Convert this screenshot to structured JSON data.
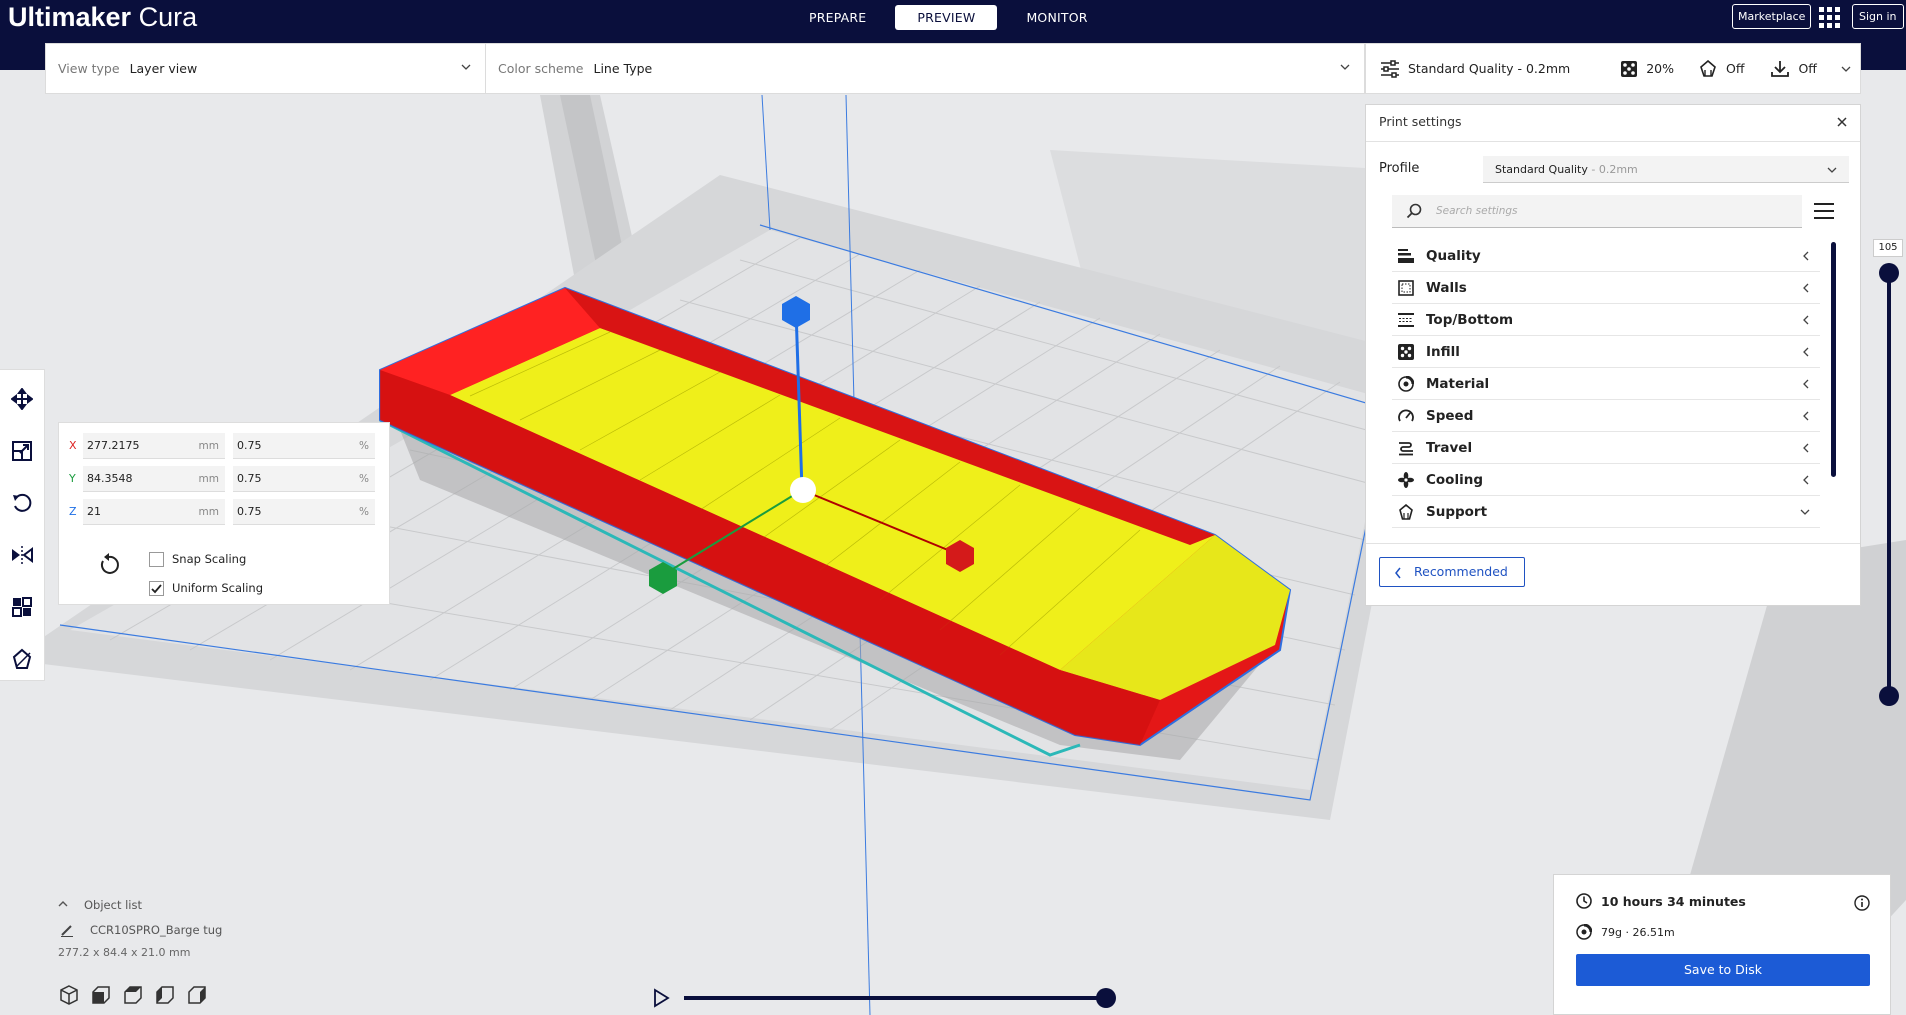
{
  "app": {
    "brand_bold": "Ultimaker",
    "brand_light": "Cura"
  },
  "stages": [
    {
      "label": "PREPARE",
      "active": false
    },
    {
      "label": "PREVIEW",
      "active": true
    },
    {
      "label": "MONITOR",
      "active": false
    }
  ],
  "header_right": {
    "marketplace": "Marketplace",
    "signin": "Sign in"
  },
  "viewbar": {
    "view_type_label": "View type",
    "view_type_value": "Layer view",
    "color_scheme_label": "Color scheme",
    "color_scheme_value": "Line Type"
  },
  "print_setup": {
    "profile": "Standard Quality - 0.2mm",
    "infill": "20%",
    "support": "Off",
    "adhesion": "Off"
  },
  "print_settings": {
    "title": "Print settings",
    "profile_label": "Profile",
    "profile_name": "Standard Quality",
    "profile_sub": " - 0.2mm",
    "search_placeholder": "Search settings",
    "categories": [
      {
        "label": "Quality",
        "icon": "quality-icon",
        "expanded": false
      },
      {
        "label": "Walls",
        "icon": "walls-icon",
        "expanded": false
      },
      {
        "label": "Top/Bottom",
        "icon": "top-bottom-icon",
        "expanded": false
      },
      {
        "label": "Infill",
        "icon": "infill-icon",
        "expanded": false
      },
      {
        "label": "Material",
        "icon": "material-icon",
        "expanded": false
      },
      {
        "label": "Speed",
        "icon": "speed-icon",
        "expanded": false
      },
      {
        "label": "Travel",
        "icon": "travel-icon",
        "expanded": false
      },
      {
        "label": "Cooling",
        "icon": "cooling-icon",
        "expanded": false
      },
      {
        "label": "Support",
        "icon": "support-icon",
        "expanded": true
      }
    ],
    "recommended_label": "Recommended"
  },
  "layer_view": {
    "current_layer": "105"
  },
  "scale_tool": {
    "x_mm": "277.2175",
    "y_mm": "84.3548",
    "z_mm": "21",
    "x_pct": "0.75",
    "y_pct": "0.75",
    "z_pct": "0.75",
    "unit_mm": "mm",
    "unit_pct": "%",
    "axis_x": "X",
    "axis_y": "Y",
    "axis_z": "Z",
    "snap_scaling": "Snap Scaling",
    "snap_checked": false,
    "uniform_scaling": "Uniform Scaling",
    "uniform_checked": true
  },
  "object_list": {
    "header": "Object list",
    "item": "CCR10SPRO_Barge tug",
    "dimensions": "277.2 x 84.4 x 21.0 mm"
  },
  "job": {
    "time": "10 hours 34 minutes",
    "material": "79g · 26.51m",
    "save_label": "Save to Disk"
  },
  "colors": {
    "navy": "#0a0f3c",
    "accent": "#1c5bd6",
    "shell": "#ee1c1c",
    "infill": "#f0f000",
    "build_plate": "#d8d9db"
  }
}
